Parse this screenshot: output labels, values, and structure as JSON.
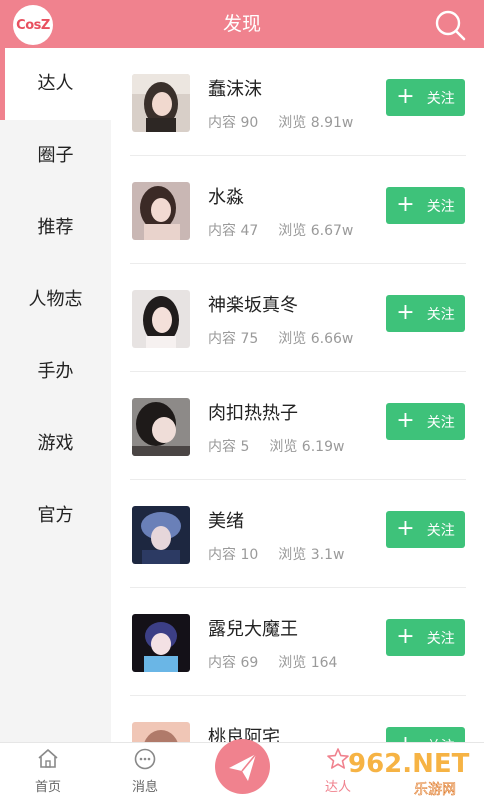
{
  "header": {
    "logo_text": "CosZ",
    "title": "发现"
  },
  "sidebar": {
    "items": [
      {
        "label": "达人",
        "active": true
      },
      {
        "label": "圈子"
      },
      {
        "label": "推荐"
      },
      {
        "label": "人物志"
      },
      {
        "label": "手办"
      },
      {
        "label": "游戏"
      },
      {
        "label": "官方"
      }
    ]
  },
  "users": [
    {
      "name": "蠢沫沫",
      "content": "内容 90",
      "views": "浏览 8.91w",
      "follow": "关注"
    },
    {
      "name": "水淼",
      "content": "内容 47",
      "views": "浏览 6.67w",
      "follow": "关注"
    },
    {
      "name": "神楽坂真冬",
      "content": "内容 75",
      "views": "浏览 6.66w",
      "follow": "关注"
    },
    {
      "name": "肉扣热热子",
      "content": "内容 5",
      "views": "浏览 6.19w",
      "follow": "关注"
    },
    {
      "name": "美绪",
      "content": "内容 10",
      "views": "浏览 3.1w",
      "follow": "关注"
    },
    {
      "name": "露兒大魔王",
      "content": "内容 69",
      "views": "浏览 164",
      "follow": "关注"
    },
    {
      "name": "桃良阿宅",
      "content": "",
      "views": "",
      "follow": "关注"
    }
  ],
  "bottom_nav": {
    "home": "首页",
    "messages": "消息",
    "experts": "达人"
  },
  "watermark": {
    "text": "962.NET",
    "sub": "乐游网"
  },
  "colors": {
    "brand": "#f0828e",
    "follow": "#3ec27a",
    "sidebar_bg": "#f4f4f4"
  }
}
